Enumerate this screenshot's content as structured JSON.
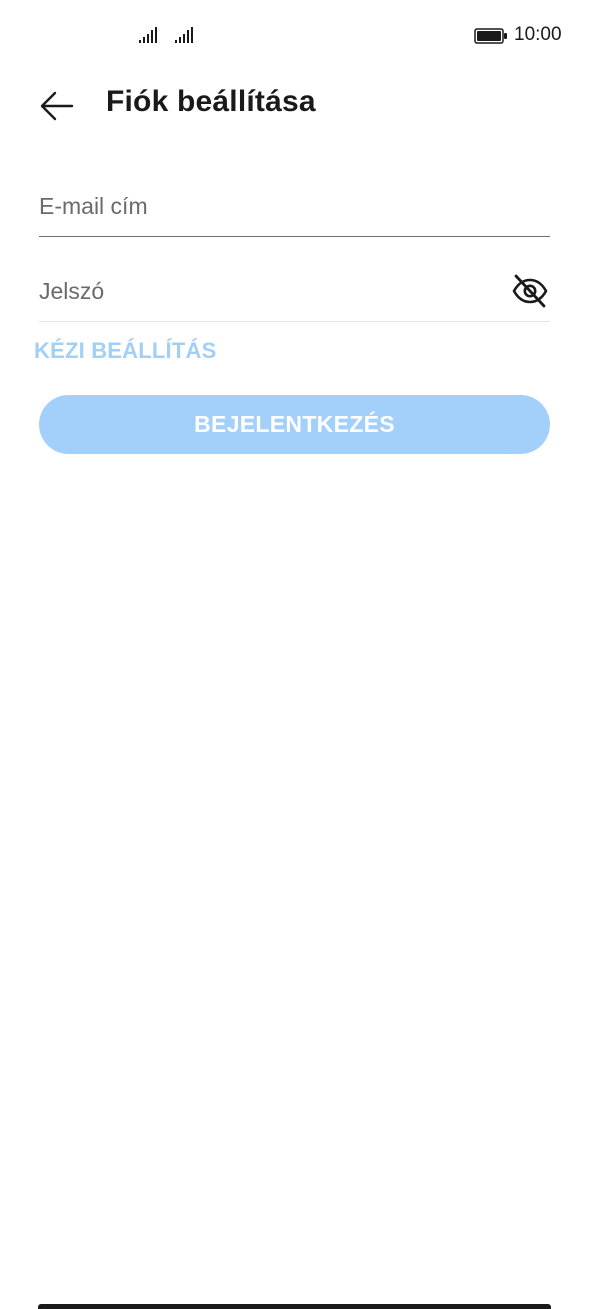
{
  "status_bar": {
    "time": "10:00",
    "signal_icons": [
      "signal-icon",
      "signal-icon"
    ],
    "battery_icon": "battery-icon"
  },
  "header": {
    "back_icon": "arrow-left-icon",
    "title": "Fiók beállítása"
  },
  "form": {
    "email": {
      "placeholder": "E-mail cím",
      "value": ""
    },
    "password": {
      "placeholder": "Jelszó",
      "value": "",
      "visibility_icon": "eye-off-icon"
    },
    "manual_setup_label": "KÉZI BEÁLLÍTÁS",
    "login_label": "BEJELENTKEZÉS"
  },
  "colors": {
    "accent_light": "#a3d0fb",
    "link": "#a3cff5",
    "text": "#1a1a1a",
    "placeholder": "#6a6a6a"
  }
}
